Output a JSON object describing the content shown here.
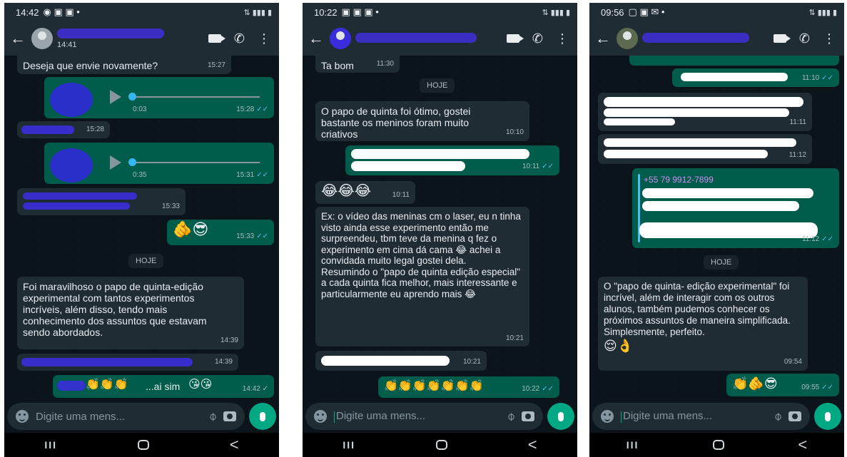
{
  "phones": [
    {
      "status_time": "14:42",
      "header_subtitle": "14:41",
      "messages": {
        "m1_text": "Deseja que envie novamente?",
        "m1_time": "15:27",
        "m2_audio_dur": "0:03",
        "m2_time": "15:28",
        "m3_time": "15:28",
        "m4_audio_dur": "0:35",
        "m4_time": "15:31",
        "m5_time": "15:33",
        "m6_time": "15:33",
        "date_label": "HOJE",
        "m7_text": "Foi maravilhoso o papo de quinta-edição experimental com tantos experimentos incríveis, além disso, tendo mais conhecimento dos assuntos que estavam sendo abordados.",
        "m7_time": "14:39",
        "m8_time": "14:39",
        "m9_text": "...ai sim",
        "m9_time": "14:42"
      },
      "input_placeholder": "Digite uma mens..."
    },
    {
      "status_time": "10:22",
      "messages": {
        "m1_text": "Ta bom",
        "m1_time": "11:30",
        "date_label": "HOJE",
        "m2_text": "O papo de quinta foi ótimo, gostei bastante os meninos foram muito criativos",
        "m2_time": "10:10",
        "m3_time": "10:11",
        "m4_time": "10:11",
        "m5_text": "Ex: o vídeo das meninas cm o laser, eu n tinha visto ainda esse experimento então me surpreendeu, tbm teve da menina q fez o experimento em cima dá cama",
        "m5_text2": "achei a convidada muito legal gostei dela.",
        "m5_text3": "Resumindo o \"papo de quinta edição especial\" a cada quinta fica melhor, mais interessante e particularmente eu aprendo mais",
        "m5_time": "10:21",
        "m6_time": "10:21",
        "m7_time": "10:22"
      },
      "input_placeholder": "Digite uma mens..."
    },
    {
      "status_time": "09:56",
      "messages": {
        "m1_time": "11:10",
        "m2_time": "11:11",
        "m3_time": "11:12",
        "m4_contact": "+55 79 9912-7899",
        "m4_time": "11:12",
        "date_label": "HOJE",
        "m5_text": "O \"papo de quinta- edição experimental\" foi incrível, além de interagir com os outros alunos, também pudemos conhecer os próximos assuntos de maneira simplificada. Simplesmente, perfeito.",
        "m5_time": "09:54",
        "m6_time": "09:55"
      },
      "input_placeholder": "Digite uma mens..."
    }
  ],
  "icons": {
    "back": "←",
    "menu": "⋮",
    "phone": "✆",
    "tick": "✓✓",
    "single_tick": "✓",
    "nav_recent": "III",
    "nav_back": "<"
  },
  "emoji": {
    "sunglasses": "😎",
    "pointing": "🫵😎",
    "laugh3": "😂😂😂",
    "laugh": "😂",
    "clap7": "👏👏👏👏👏👏👏",
    "clap3": "👏👏👏",
    "kiss": "😘😘",
    "pensive_ok": "😌👌",
    "hands_sun": "👏🫵😎"
  }
}
